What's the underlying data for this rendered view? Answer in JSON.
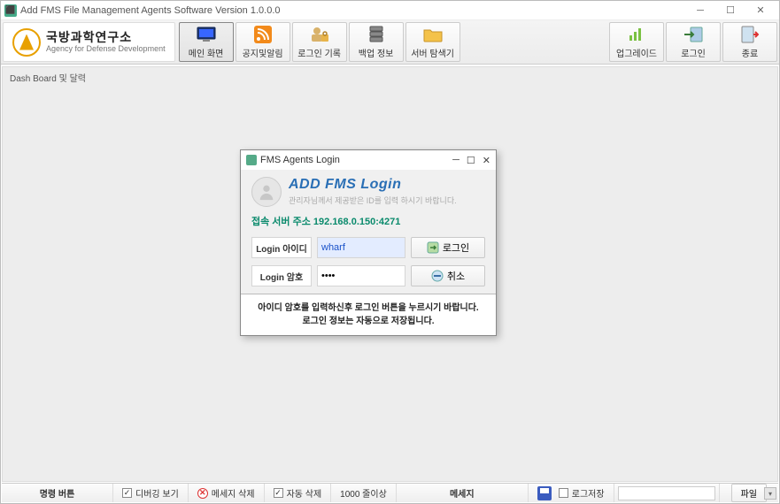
{
  "window": {
    "title": "Add FMS File Management Agents Software Version 1.0.0.0"
  },
  "brand": {
    "name_ko": "국방과학연구소",
    "name_en": "Agency for Defense Development"
  },
  "toolbar": {
    "main": "메인 화면",
    "notice": "공지및알림",
    "login_log": "로그인 기록",
    "backup": "백업 정보",
    "explorer": "서버 탐색기",
    "upgrade": "업그레이드",
    "login": "로그인",
    "exit": "종료"
  },
  "breadcrumb": "Dash Board 및 달력",
  "modal": {
    "titlebar": "FMS Agents Login",
    "title": "ADD FMS Login",
    "subtitle": "관리자님께서 제공받은 ID를 입력 하시기 바랍니다.",
    "server_label": "접속 서버 주소",
    "server_addr": "192.168.0.150:4271",
    "id_label": "Login 아이디",
    "id_value": "wharf",
    "pw_label": "Login 암호",
    "pw_value": "****",
    "login_btn": "로그인",
    "cancel_btn": "취소",
    "footer_1": "아이디 암호를 입력하신후 로그인 버튼을 누르시기 바랍니다.",
    "footer_2": "로그인 정보는 자동으로 저장됩니다."
  },
  "statusbar": {
    "cmd_btn": "명령 버튼",
    "debug_view": "디버깅 보기",
    "debug_checked": true,
    "msg_delete": "메세지 삭제",
    "auto_delete": "자동 삭제",
    "auto_checked": true,
    "lines": "1000 줄이상",
    "message": "메세지",
    "log_save": "로그저장",
    "log_checked": false,
    "file": "파일"
  }
}
